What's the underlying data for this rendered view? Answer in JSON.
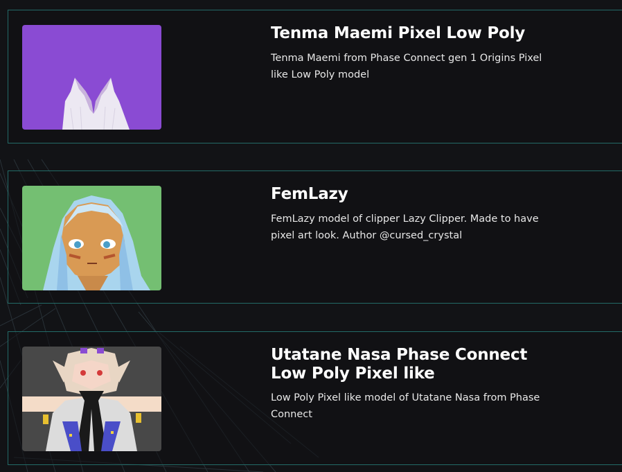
{
  "theme": {
    "background": "#121316",
    "card_border": "#236b68",
    "title_color": "#ffffff",
    "text_color": "#e8e8e8"
  },
  "items": [
    {
      "title": "Tenma Maemi Pixel Low Poly",
      "description": "Tenma Maemi from Phase Connect gen 1 Origins Pixel like Low Poly model",
      "thumbnail_bg": "#8a4bd3"
    },
    {
      "title": "FemLazy",
      "description": "FemLazy model of clipper Lazy Clipper. Made to have pixel art look. Author @cursed_crystal",
      "thumbnail_bg": "#74bf72"
    },
    {
      "title": "Utatane Nasa Phase Connect Low Poly Pixel like",
      "description": "Low Poly Pixel like model of Utatane Nasa from Phase Connect",
      "thumbnail_bg": "#484848"
    }
  ]
}
